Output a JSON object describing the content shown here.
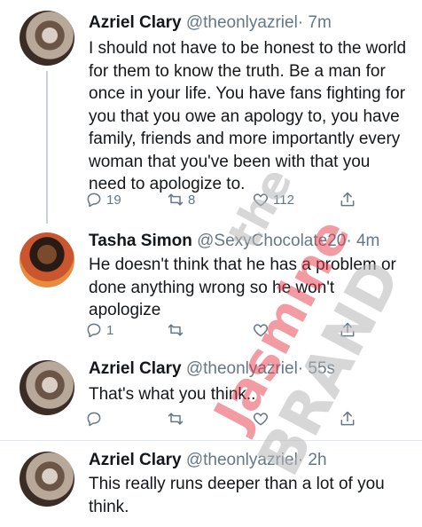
{
  "tweets": [
    {
      "name": "Azriel Clary",
      "handle": "@theonlyazriel",
      "time": "· 7m",
      "text": "I should not have to be honest to the world for them to know the truth. Be a man for once in your life. You have fans fighting for you that you owe an apology to, you have family, friends and more importantly every woman that you've been with that you need to apologize to.",
      "replies": "19",
      "retweets": "8",
      "likes": "112"
    },
    {
      "name": "Tasha Simon",
      "handle": "@SexyChocolate20",
      "time": "· 4m",
      "text": "He doesn't think that he has a problem or done anything wrong so he won't apologize",
      "replies": "1",
      "retweets": "",
      "likes": ""
    },
    {
      "name": "Azriel Clary",
      "handle": "@theonlyazriel",
      "time": "· 55s",
      "text": "That's what you think..",
      "replies": "",
      "retweets": "",
      "likes": ""
    },
    {
      "name": "Azriel Clary",
      "handle": "@theonlyazriel",
      "time": "· 2h",
      "text": "This really runs deeper than a lot of you think."
    }
  ],
  "watermark": {
    "line1": "the",
    "line2": "Jasmine",
    "line3": "BRAND",
    "colors": {
      "red": "#e8394a",
      "gray": "#b8b8b8"
    }
  },
  "icons": [
    "reply-icon",
    "retweet-icon",
    "like-icon",
    "share-icon"
  ]
}
